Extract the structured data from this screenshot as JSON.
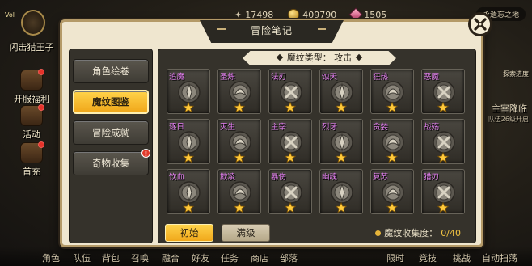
{
  "background": {
    "player_name": "闪击猎王子",
    "player_level": "Vol",
    "resources": [
      {
        "icon": "feather-icon",
        "value": "17498"
      },
      {
        "icon": "coin-icon",
        "value": "409790"
      },
      {
        "icon": "gem-icon",
        "value": "1505"
      }
    ],
    "region_label": "永遗忘之地",
    "left_menu": [
      "开服福利",
      "活动",
      "首充"
    ],
    "right_labels": [
      "主宰降临",
      "队伍26级开启",
      "探索进度"
    ],
    "bottom_nav": [
      "角色",
      "队伍",
      "背包",
      "召唤",
      "融合",
      "好友",
      "任务",
      "商店",
      "部落",
      "限时",
      "竞技",
      "挑战",
      "自动扫荡"
    ]
  },
  "modal": {
    "title": "冒险笔记",
    "sidebar": [
      {
        "label": "角色绘卷",
        "active": false,
        "badge": ""
      },
      {
        "label": "魔纹图鉴",
        "active": true,
        "badge": ""
      },
      {
        "label": "冒险成就",
        "active": false,
        "badge": ""
      },
      {
        "label": "奇物收集",
        "active": false,
        "badge": "!"
      }
    ],
    "type_banner": "魔纹类型： 攻击",
    "runes": [
      {
        "name": "追魔"
      },
      {
        "name": "圣炼"
      },
      {
        "name": "法刃"
      },
      {
        "name": "蚀天"
      },
      {
        "name": "狂热"
      },
      {
        "name": "恶魇"
      },
      {
        "name": "逐日"
      },
      {
        "name": "灭生"
      },
      {
        "name": "主宰"
      },
      {
        "name": "烈牙"
      },
      {
        "name": "贪婪"
      },
      {
        "name": "战殇"
      },
      {
        "name": "饮血"
      },
      {
        "name": "欺凌"
      },
      {
        "name": "暴伤"
      },
      {
        "name": "幽魂"
      },
      {
        "name": "复苏"
      },
      {
        "name": "猎刃"
      }
    ],
    "buttons": {
      "initial": "初始",
      "max": "满级"
    },
    "collection": {
      "label": "魔纹收集度：",
      "value": "0/40"
    }
  },
  "colors": {
    "accent": "#f0a71a",
    "rune_name": "#e27cf0",
    "panel": "#35322b",
    "frame": "#efe6cf"
  }
}
